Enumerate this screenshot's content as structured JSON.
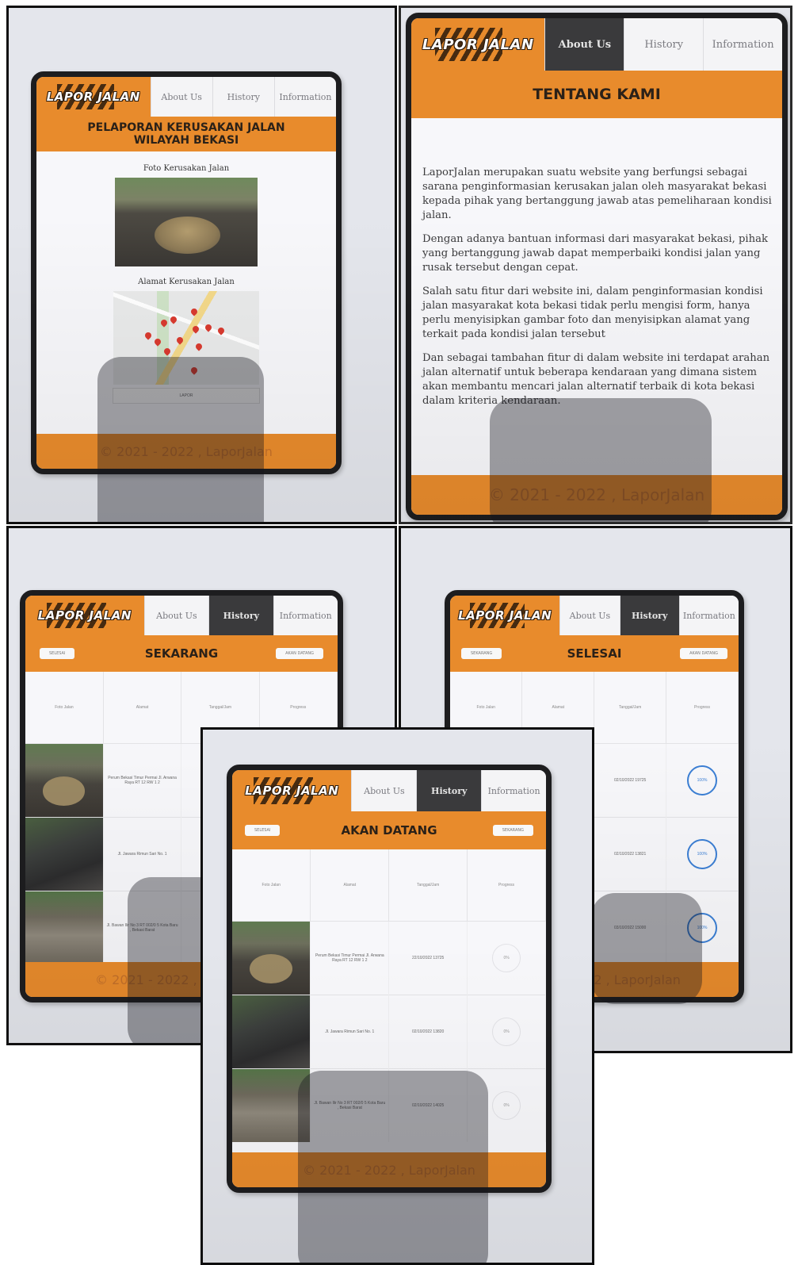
{
  "brand": {
    "logo_text": "LAPOR JALAN",
    "primary_color": "#e88b2c",
    "dark_tab_color": "#3a3a3c"
  },
  "nav": {
    "about": "About Us",
    "history": "History",
    "information": "Information"
  },
  "footer": "© 2021 - 2022 , LaporJalan",
  "home": {
    "title": "PELAPORAN KERUSAKAN JALAN WILAYAH BEKASI",
    "photo_label": "Foto Kerusakan Jalan",
    "address_label": "Alamat Kerusakan Jalan",
    "submit_label": "LAPOR"
  },
  "about": {
    "title": "TENTANG KAMI",
    "paragraphs": [
      "LaporJalan merupakan suatu website yang berfungsi sebagai sarana penginformasian kerusakan jalan oleh masyarakat bekasi kepada pihak yang bertanggung jawab atas pemeliharaan kondisi jalan.",
      "Dengan adanya bantuan informasi dari masyarakat bekasi, pihak yang bertanggung jawab dapat memperbaiki kondisi jalan yang rusak tersebut dengan cepat.",
      "Salah satu fitur dari website ini, dalam penginformasian kondisi jalan masyarakat kota bekasi tidak perlu mengisi form, hanya perlu menyisipkan gambar foto dan menyisipkan alamat yang terkait pada kondisi jalan tersebut",
      "Dan sebagai tambahan fitur di dalam website ini terdapat arahan jalan alternatif untuk beberapa kendaraan yang dimana sistem akan membantu mencari jalan alternatif terbaik di kota bekasi dalam kriteria kendaraan."
    ]
  },
  "table_headers": [
    "Foto Jalan",
    "Alamat",
    "Tanggal/Jam",
    "Progress"
  ],
  "sekarang": {
    "title": "SEKARANG",
    "left_pill": "SELESAI",
    "right_pill": "AKAN DATANG",
    "rows": [
      {
        "alamat": "Perum Bekasi Timur Permai Jl. Arwana Raya RT 12 RW 1 2",
        "tanggal": "",
        "progress": ""
      },
      {
        "alamat": "Jl. Jawara Rimun Sari No. 1",
        "tanggal": "",
        "progress": ""
      },
      {
        "alamat": "Jl. Bawan Ilir No 3 RT 002/0 5 Kota Baru , Bekasi Barat",
        "tanggal": "",
        "progress": ""
      }
    ]
  },
  "selesai": {
    "title": "SELESAI",
    "left_pill": "SEKARANG",
    "right_pill": "AKAN DATANG",
    "rows": [
      {
        "alamat": "",
        "tanggal": "02/10/2022 19725",
        "progress": "100%"
      },
      {
        "alamat": "",
        "tanggal": "02/10/2022 13821",
        "progress": "100%"
      },
      {
        "alamat": "",
        "tanggal": "03/10/2022 15000",
        "progress": "100%"
      }
    ]
  },
  "akan_datang": {
    "title": "AKAN DATANG",
    "left_pill": "SELESAI",
    "right_pill": "SEKARANG",
    "rows": [
      {
        "alamat": "Perum Bekasi Timur Permai Jl. Arwana Raya RT 12 RW 1 2",
        "tanggal": "22/10/2022 13725",
        "progress": "0%"
      },
      {
        "alamat": "Jl. Jawara Rimun Sari No. 1",
        "tanggal": "02/10/2022 13820",
        "progress": "0%"
      },
      {
        "alamat": "Jl. Bawan Ilir No 3 RT 002/0 5 Kota Baru , Bekasi Barat",
        "tanggal": "02/10/2022 14025",
        "progress": "0%"
      }
    ]
  }
}
